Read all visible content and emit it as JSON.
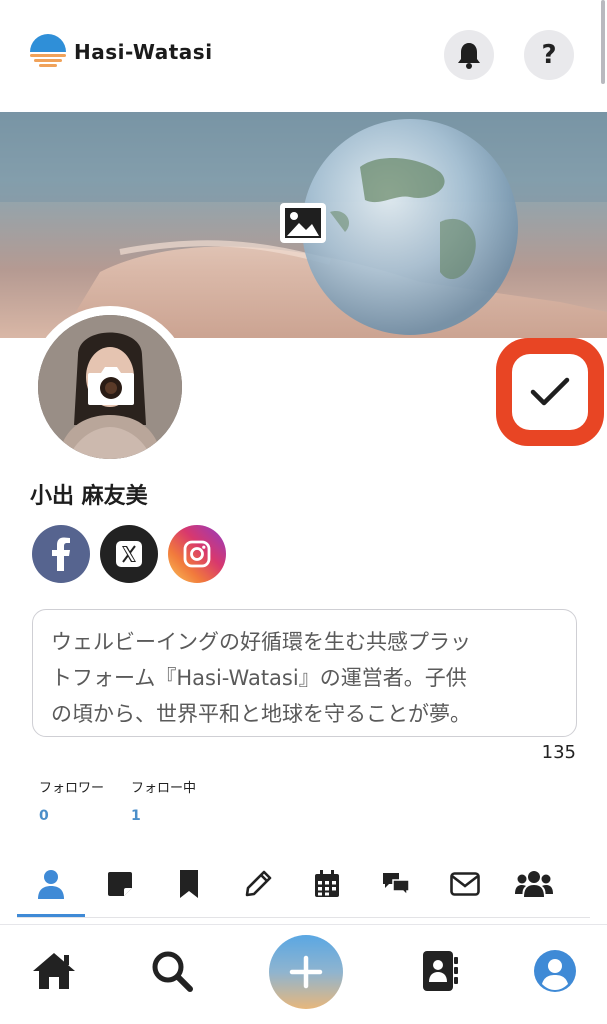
{
  "app": {
    "name": "Hasi-Watasi"
  },
  "header": {
    "help_label": "?"
  },
  "profile": {
    "name": "小出 麻友美",
    "bio_lines": [
      "ウェルビーイングの好循環を生む共感プラッ",
      "トフォーム『Hasi-Watasi』の運営者。子供",
      "の頃から、世界平和と地球を守ることが夢。"
    ],
    "bio_count": "135",
    "followers_label": "フォロワー",
    "followers_count": "0",
    "following_label": "フォロー中",
    "following_count": "1"
  },
  "social": [
    "facebook-icon",
    "x-icon",
    "instagram-icon"
  ],
  "tabs": [
    {
      "icon": "person-icon",
      "active": true
    },
    {
      "icon": "sticky-note-icon",
      "active": false
    },
    {
      "icon": "bookmark-icon",
      "active": false
    },
    {
      "icon": "pencil-icon",
      "active": false
    },
    {
      "icon": "calendar-icon",
      "active": false
    },
    {
      "icon": "comments-icon",
      "active": false
    },
    {
      "icon": "envelope-icon",
      "active": false
    },
    {
      "icon": "users-icon",
      "active": false
    }
  ],
  "bottom_nav": [
    "home-icon",
    "search-icon",
    "plus-icon",
    "contacts-icon",
    "account-icon"
  ],
  "colors": {
    "accent": "#3f8ad6",
    "save_highlight": "#e84524",
    "count_blue": "#4b8ec9"
  }
}
